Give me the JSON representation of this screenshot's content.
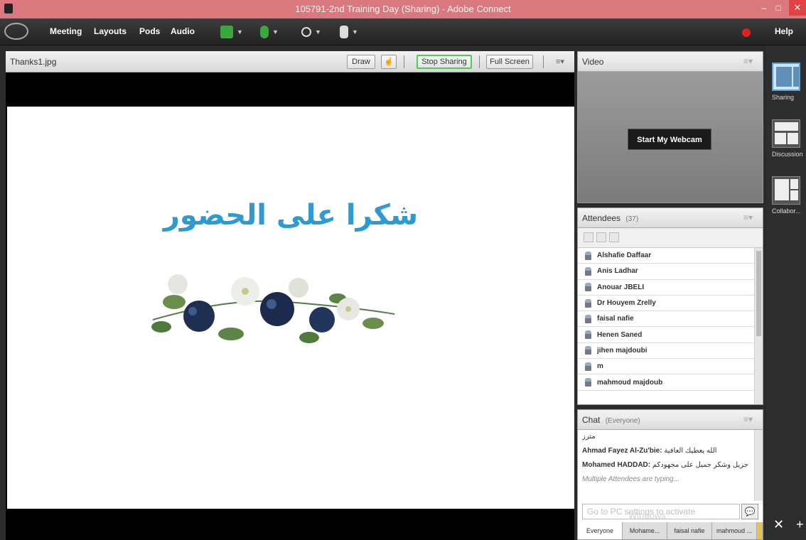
{
  "window": {
    "title": "105791-2nd Training Day (Sharing) - Adobe Connect"
  },
  "menubar": {
    "items": [
      "Meeting",
      "Layouts",
      "Pods",
      "Audio"
    ],
    "help_label": "Help"
  },
  "share_pod": {
    "title": "Thanks1.jpg",
    "draw_label": "Draw",
    "stop_sharing_label": "Stop Sharing",
    "full_screen_label": "Full Screen",
    "slide_text": "شكرا على الحضور"
  },
  "video_pod": {
    "title": "Video",
    "webcam_button": "Start My Webcam"
  },
  "attendees_pod": {
    "title": "Attendees",
    "count": "(37)",
    "list": [
      "Alshafie Daffaar",
      "Anis Ladhar",
      "Anouar JBELI",
      "Dr Houyem Zrelly",
      "faisal nafie",
      "Henen Saned",
      "jihen majdoubi",
      "m",
      "mahmoud majdoub"
    ]
  },
  "chat_pod": {
    "title": "Chat",
    "scope": "(Everyone)",
    "messages": [
      {
        "sender": "",
        "text": "مترز"
      },
      {
        "sender": "Ahmad Fayez Al-Zu'bie:",
        "text": "الله يعطيك العافية"
      },
      {
        "sender": "Mohamed HADDAD:",
        "text": "الشكر لكم جزيل وشكر جميل على مجهودكم"
      }
    ],
    "typing": "Multiple Attendees are typing...",
    "input_placeholder": "Go to PC settings to activate",
    "tabs": [
      "Everyone",
      "Mohame...",
      "faisal nafie",
      "mahmoud ..."
    ]
  },
  "layouts": [
    {
      "label": "Sharing",
      "active": true
    },
    {
      "label": "Discussion",
      "active": false
    },
    {
      "label": "Collabor...",
      "active": false
    }
  ],
  "overlay": {
    "watermark": "Windows"
  },
  "colors": {
    "titlebar": "#d9797e",
    "slide_text": "#2d9ad1",
    "stop_sharing_border": "#56c95a",
    "record_dot": "#e02020"
  }
}
